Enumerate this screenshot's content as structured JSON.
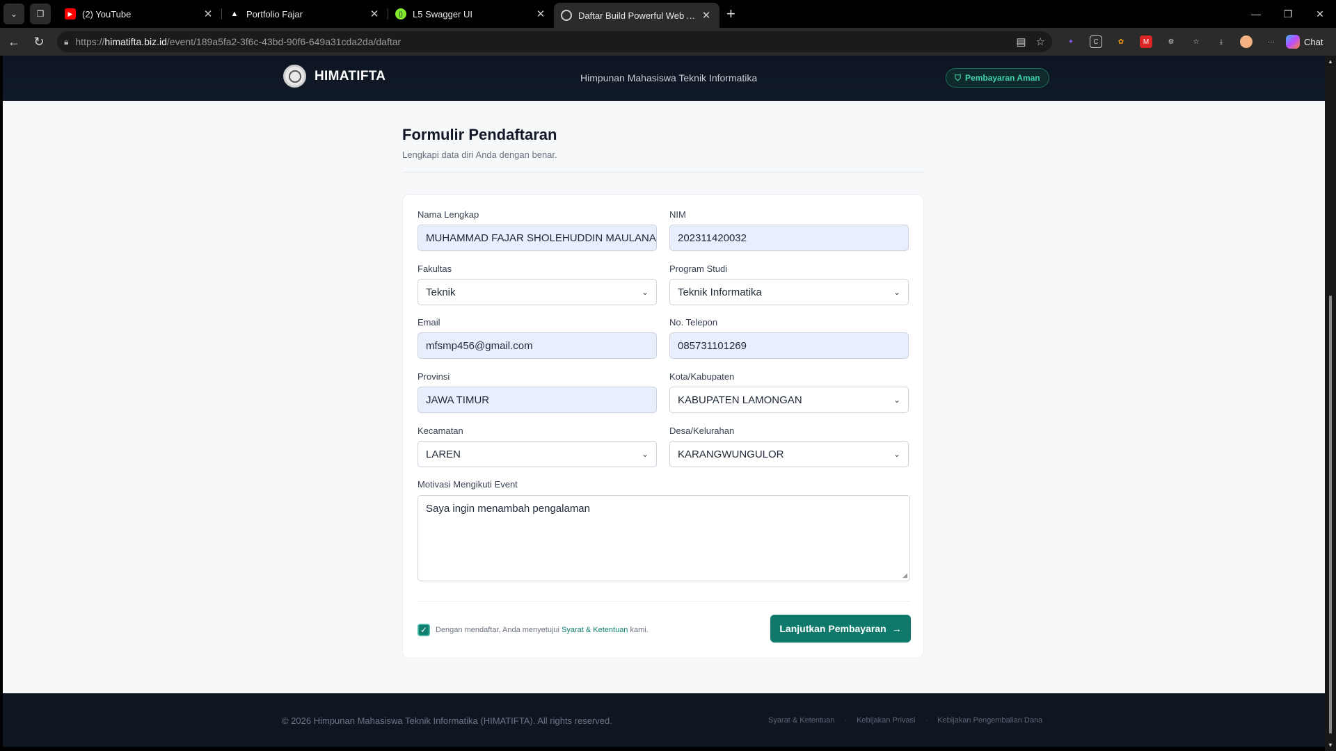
{
  "browser": {
    "tabs": [
      {
        "title": "(2) YouTube",
        "icon": "youtube-icon",
        "color": "#ff0000"
      },
      {
        "title": "Portfolio Fajar",
        "icon": "triangle-icon",
        "color": "#ffffff"
      },
      {
        "title": "L5 Swagger UI",
        "icon": "swagger-icon",
        "color": "#85ea2d"
      },
      {
        "title": "Daftar Build Powerful Web Apps w",
        "icon": "site-icon",
        "color": "#cccccc",
        "active": true
      }
    ],
    "url_prefix": "https://",
    "url_domain": "himatifta.biz.id",
    "url_path": "/event/189a5fa2-3f6c-43bd-90f6-649a31cda2da/daftar",
    "chat_label": "Chat"
  },
  "header": {
    "brand": "HIMATIFTA",
    "subtitle": "Himpunan Mahasiswa Teknik Informatika",
    "badge": "Pembayaran Aman"
  },
  "form": {
    "title": "Formulir Pendaftaran",
    "subtitle": "Lengkapi data diri Anda dengan benar.",
    "fields": {
      "nama": {
        "label": "Nama Lengkap",
        "value": "MUHAMMAD FAJAR SHOLEHUDDIN MAULANA P"
      },
      "nim": {
        "label": "NIM",
        "value": "202311420032"
      },
      "fakultas": {
        "label": "Fakultas",
        "value": "Teknik"
      },
      "prodi": {
        "label": "Program Studi",
        "value": "Teknik Informatika"
      },
      "email": {
        "label": "Email",
        "value": "mfsmp456@gmail.com"
      },
      "telepon": {
        "label": "No. Telepon",
        "value": "085731101269"
      },
      "provinsi": {
        "label": "Provinsi",
        "value": "JAWA TIMUR"
      },
      "kota": {
        "label": "Kota/Kabupaten",
        "value": "KABUPATEN LAMONGAN"
      },
      "kecamatan": {
        "label": "Kecamatan",
        "value": "LAREN"
      },
      "desa": {
        "label": "Desa/Kelurahan",
        "value": "KARANGWUNGULOR"
      },
      "motivasi": {
        "label": "Motivasi Mengikuti Event",
        "value": "Saya ingin menambah pengalaman"
      }
    },
    "agree_prefix": "Dengan mendaftar, Anda menyetujui",
    "agree_link": "Syarat & Ketentuan",
    "agree_suffix": "kami.",
    "submit_label": "Lanjutkan Pembayaran"
  },
  "footer": {
    "copyright": "© 2026 Himpunan Mahasiswa Teknik Informatika (HIMATIFTA). All rights reserved.",
    "links": [
      "Syarat & Ketentuan",
      "Kebijakan Privasi",
      "Kebijakan Pengembalian Dana"
    ]
  },
  "colors": {
    "accent": "#0f7a6c",
    "header_bg": "#0d1522",
    "input_fill": "#e8eefb"
  }
}
